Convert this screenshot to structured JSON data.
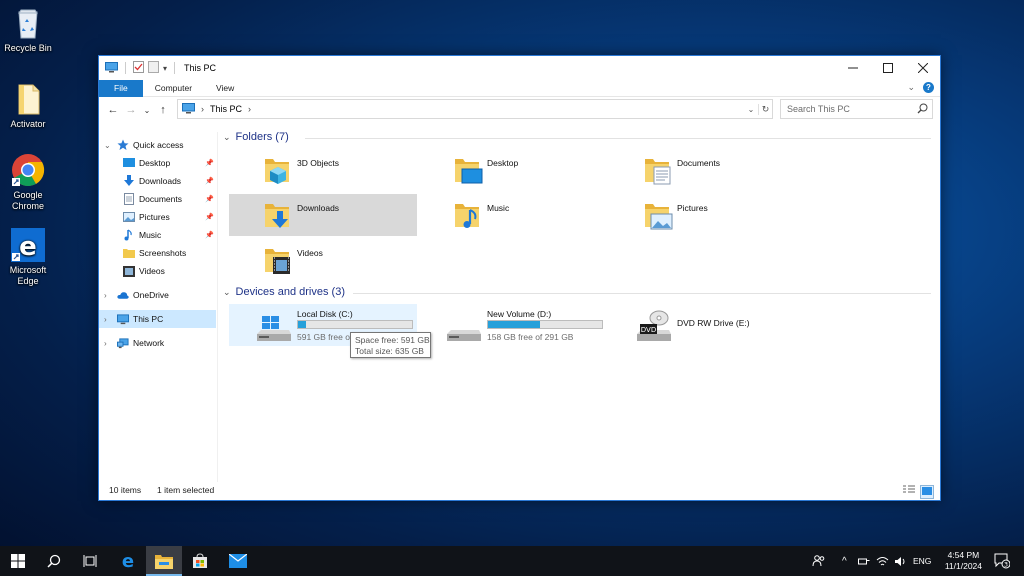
{
  "desktop": {
    "icons": [
      {
        "label": "Recycle Bin"
      },
      {
        "label": "Activator"
      },
      {
        "label": "Google Chrome"
      },
      {
        "label": "Microsoft Edge"
      }
    ]
  },
  "window": {
    "title": "This PC",
    "ribbon_tabs": [
      "File",
      "Computer",
      "View"
    ],
    "address": {
      "path": "This PC"
    },
    "search_placeholder": "Search This PC",
    "nav": {
      "quick_access": "Quick access",
      "quick_items": [
        "Desktop",
        "Downloads",
        "Documents",
        "Pictures",
        "Music",
        "Screenshots",
        "Videos"
      ],
      "onedrive": "OneDrive",
      "this_pc": "This PC",
      "network": "Network"
    },
    "folders_header": "Folders (7)",
    "folders": [
      "3D Objects",
      "Desktop",
      "Documents",
      "Downloads",
      "Music",
      "Pictures",
      "Videos"
    ],
    "drives_header": "Devices and drives (3)",
    "drives": [
      {
        "name": "Local Disk (C:)",
        "free": "591 GB free of 635 GB",
        "used_fraction": 0.07
      },
      {
        "name": "New Volume (D:)",
        "free": "158 GB free of 291 GB",
        "used_fraction": 0.46
      },
      {
        "name": "DVD RW Drive (E:)",
        "badge": "DVD"
      }
    ],
    "tooltip": {
      "line1": "Space free: 591 GB",
      "line2": "Total size: 635 GB"
    },
    "status": {
      "items": "10 items",
      "selected": "1 item selected"
    }
  },
  "taskbar": {
    "lang": "ENG",
    "time": "4:54 PM",
    "date": "11/1/2024",
    "notification_count": "3"
  },
  "colors": {
    "accent": "#1979ca",
    "selection": "#cce8ff",
    "bar_fill": "#26a0da"
  }
}
